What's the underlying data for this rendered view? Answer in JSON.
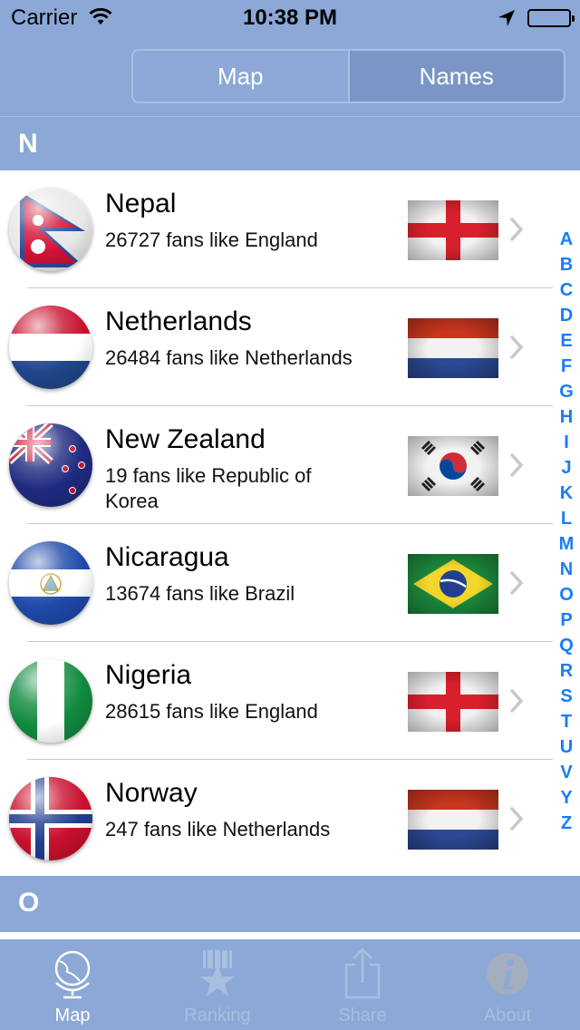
{
  "status_bar": {
    "carrier": "Carrier",
    "time": "10:38 PM"
  },
  "segmented": {
    "map_label": "Map",
    "names_label": "Names",
    "selected": "Names"
  },
  "sections": [
    {
      "letter": "N"
    },
    {
      "letter": "O"
    }
  ],
  "rows": [
    {
      "country": "Nepal",
      "fans": "26727 fans like England",
      "fan_team": "England"
    },
    {
      "country": "Netherlands",
      "fans": "26484 fans like Netherlands",
      "fan_team": "Netherlands"
    },
    {
      "country": "New Zealand",
      "fans": "19 fans like Republic of Korea",
      "fan_team": "Republic of Korea"
    },
    {
      "country": "Nicaragua",
      "fans": "13674 fans like Brazil",
      "fan_team": "Brazil"
    },
    {
      "country": "Nigeria",
      "fans": "28615 fans like England",
      "fan_team": "England"
    },
    {
      "country": "Norway",
      "fans": "247 fans like Netherlands",
      "fan_team": "Netherlands"
    }
  ],
  "index_letters": [
    "A",
    "B",
    "C",
    "D",
    "E",
    "F",
    "G",
    "H",
    "I",
    "J",
    "K",
    "L",
    "M",
    "N",
    "O",
    "P",
    "Q",
    "R",
    "S",
    "T",
    "U",
    "V",
    "Y",
    "Z"
  ],
  "tabs": [
    {
      "label": "Map",
      "icon": "globe-icon",
      "selected": true
    },
    {
      "label": "Ranking",
      "icon": "ranking-star-icon",
      "selected": false
    },
    {
      "label": "Share",
      "icon": "share-icon",
      "selected": false
    },
    {
      "label": "About",
      "icon": "info-icon",
      "selected": false
    }
  ],
  "colors": {
    "bar": "#8ba8d6",
    "accent_index": "#1a7cf7",
    "chevron": "#c7c7cc"
  }
}
